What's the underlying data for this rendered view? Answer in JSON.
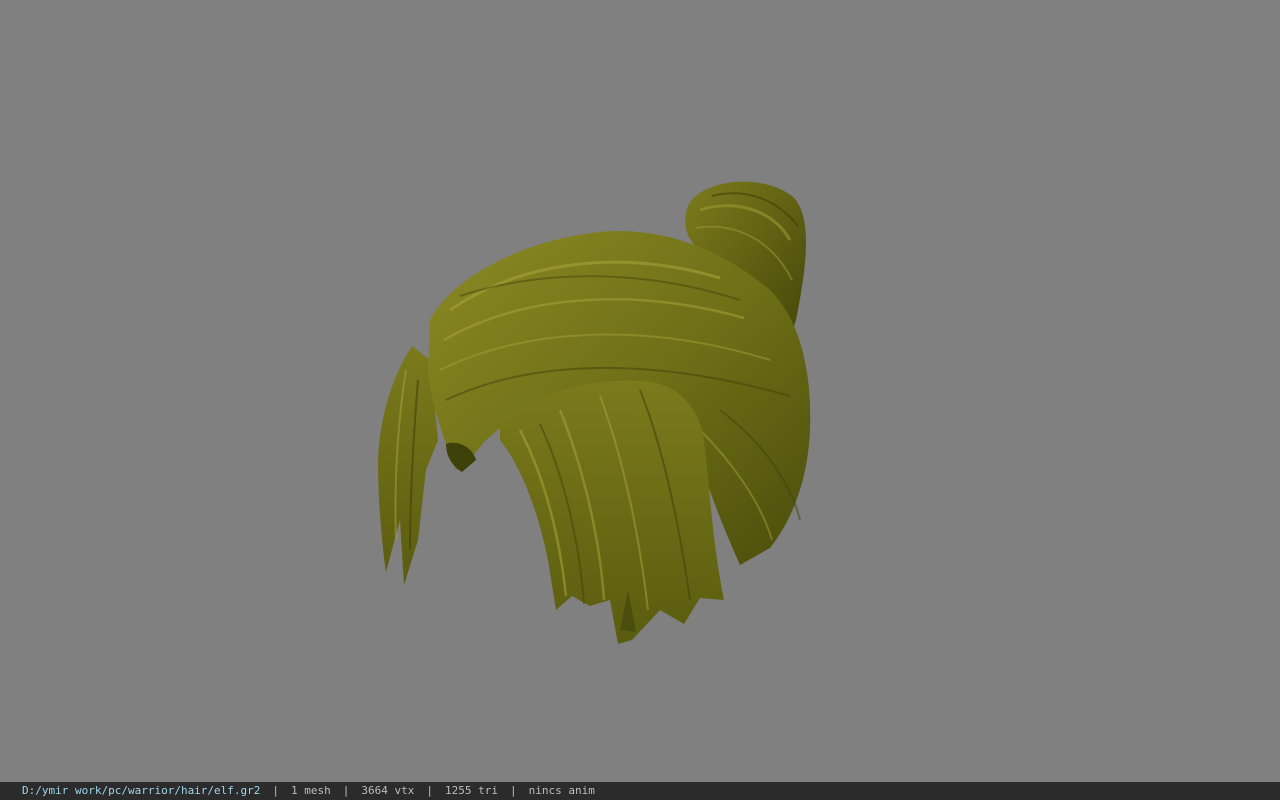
{
  "viewport": {
    "background_color": "#808080",
    "model": {
      "icon": "hair-mesh-model",
      "base_color": "#6f7017",
      "highlight_color": "#a9a63d",
      "shadow_color": "#3f410a"
    }
  },
  "status_bar": {
    "file_path": "D:/ymir work/pc/warrior/hair/elf.gr2",
    "separator": "|",
    "mesh_count": "1 mesh",
    "vertex_count": "3664 vtx",
    "triangle_count": "1255 tri",
    "animation": "nincs anim"
  }
}
